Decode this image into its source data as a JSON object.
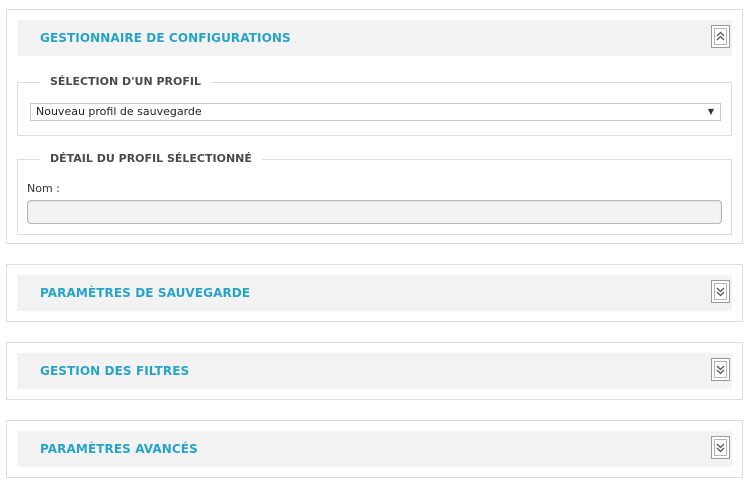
{
  "colors": {
    "section_title": "#27a3c8",
    "header_bg": "#f2f2f2",
    "border": "#dcdcdc"
  },
  "config_manager": {
    "title": "GESTIONNAIRE DE CONFIGURATIONS",
    "toggle_icon": "chevron-double-up-icon",
    "profile_selection": {
      "legend": "SÉLECTION D'UN PROFIL",
      "selected": "Nouveau profil de sauvegarde",
      "arrow": "▼"
    },
    "profile_detail": {
      "legend": "DÉTAIL DU PROFIL SÉLECTIONNÉ",
      "name_label": "Nom :",
      "name_value": ""
    }
  },
  "sections": [
    {
      "title": "PARAMÈTRES DE SAUVEGARDE",
      "toggle_icon": "chevron-double-down-icon"
    },
    {
      "title": "GESTION DES FILTRES",
      "toggle_icon": "chevron-double-down-icon"
    },
    {
      "title": "PARAMÈTRES AVANCÉS",
      "toggle_icon": "chevron-double-down-icon"
    }
  ]
}
